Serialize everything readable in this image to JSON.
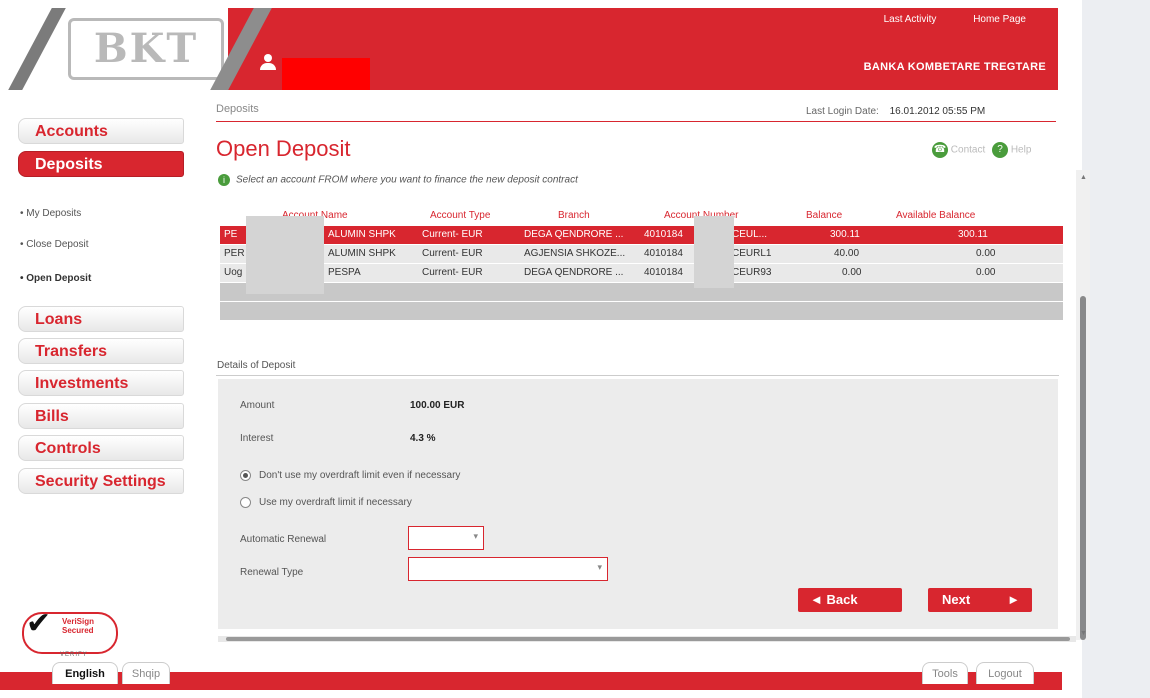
{
  "header": {
    "logo_text": "BKT",
    "top_links": [
      "Last Activity",
      "Home Page"
    ],
    "bank_name": "BANKA KOMBETARE TREGTARE"
  },
  "colors": {
    "brand": "#d8262f",
    "active_row": "#d8262f",
    "panel": "#ececec"
  },
  "sidebar": {
    "items": [
      {
        "label": "Accounts",
        "active": false
      },
      {
        "label": "Deposits",
        "active": true
      }
    ],
    "sub_items": [
      {
        "label": "My Deposits",
        "active": false
      },
      {
        "label": "Close Deposit",
        "active": false
      },
      {
        "label": "Open Deposit",
        "active": true
      }
    ],
    "items_rest": [
      {
        "label": "Loans"
      },
      {
        "label": "Transfers"
      },
      {
        "label": "Investments"
      },
      {
        "label": "Bills"
      },
      {
        "label": "Controls"
      },
      {
        "label": "Security Settings"
      }
    ],
    "badge": {
      "text": "VeriSign Secured",
      "sub": "VERIFY"
    }
  },
  "main": {
    "breadcrumb": "Deposits",
    "last_login_label": "Last Login Date:",
    "last_login_value": "16.01.2012 05:55 PM",
    "title": "Open Deposit",
    "contact_label": "Contact",
    "help_label": "Help",
    "instruction": "Select an account FROM where you want to finance the new deposit contract"
  },
  "accounts_table": {
    "columns": [
      "Account Name",
      "Account Type",
      "Branch",
      "Account Number",
      "Balance",
      "Available Balance"
    ],
    "rows": [
      {
        "name_pre": "PE",
        "name_post": "ALUMIN SHPK",
        "type": "Current- EUR",
        "branch": "DEGA QENDRORE ...",
        "num_pre": "4010184",
        "num_post": "CEUL...",
        "balance": "300.11",
        "available": "300.11",
        "selected": true
      },
      {
        "name_pre": "PER",
        "name_post": "ALUMIN SHPK",
        "type": "Current- EUR",
        "branch": "AGJENSIA SHKOZE...",
        "num_pre": "4010184",
        "num_post": "CEURL1",
        "balance": "40.00",
        "available": "0.00",
        "selected": false
      },
      {
        "name_pre": "Uog",
        "name_post": "PESPA",
        "type": "Current- EUR",
        "branch": "DEGA QENDRORE ...",
        "num_pre": "4010184",
        "num_post": "CEUR93",
        "balance": "0.00",
        "available": "0.00",
        "selected": false
      }
    ]
  },
  "details": {
    "section_label": "Details of Deposit",
    "amount_label": "Amount",
    "amount_value": "100.00 EUR",
    "interest_label": "Interest",
    "interest_value": "4.3 %",
    "radio_options": [
      {
        "label": "Don't use my overdraft limit even if necessary",
        "selected": true
      },
      {
        "label": "Use my overdraft limit if necessary",
        "selected": false
      }
    ],
    "auto_renewal_label": "Automatic Renewal",
    "auto_renewal_value": "",
    "renewal_type_label": "Renewal Type",
    "renewal_type_value": "",
    "back_label": "Back",
    "next_label": "Next"
  },
  "footer": {
    "languages": [
      "English",
      "Shqip"
    ],
    "tools_label": "Tools",
    "logout_label": "Logout"
  }
}
